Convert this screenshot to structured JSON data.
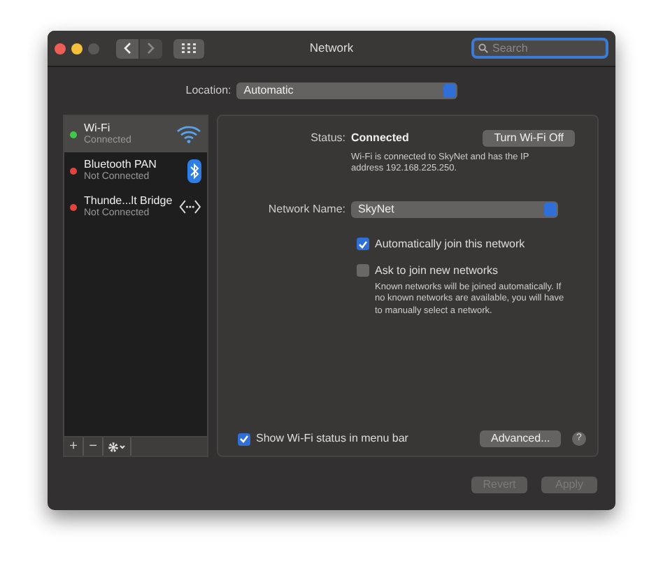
{
  "window": {
    "title": "Network",
    "search": {
      "placeholder": "Search"
    }
  },
  "location": {
    "label": "Location:",
    "value": "Automatic"
  },
  "services": [
    {
      "name": "Wi-Fi",
      "status": "Connected",
      "color": "#3fc94a",
      "selected": true,
      "kind": "wifi"
    },
    {
      "name": "Bluetooth PAN",
      "status": "Not Connected",
      "color": "#e0443e",
      "selected": false,
      "kind": "bluetooth"
    },
    {
      "name": "Thunde...lt Bridge",
      "status": "Not Connected",
      "color": "#e0443e",
      "selected": false,
      "kind": "bridge"
    }
  ],
  "sidebar_tools": [
    "+",
    "−"
  ],
  "detail": {
    "status_label": "Status:",
    "status_value": "Connected",
    "toggle_button": "Turn Wi-Fi Off",
    "status_note": "Wi-Fi is connected to SkyNet and has the IP address 192.168.225.250.",
    "network_label": "Network Name:",
    "network_value": "SkyNet",
    "options": [
      {
        "label": "Automatically join this network",
        "checked": true
      },
      {
        "label": "Ask to join new networks",
        "checked": false
      }
    ],
    "options_note": "Known networks will be joined automatically. If no known networks are available, you will have to manually select a network.",
    "menu_bar_option": {
      "label": "Show Wi-Fi status in menu bar",
      "checked": true
    },
    "advanced_button": "Advanced...",
    "help_button": "?"
  },
  "footer_buttons": [
    {
      "label": "Revert",
      "disabled": true
    },
    {
      "label": "Apply",
      "disabled": true
    }
  ]
}
